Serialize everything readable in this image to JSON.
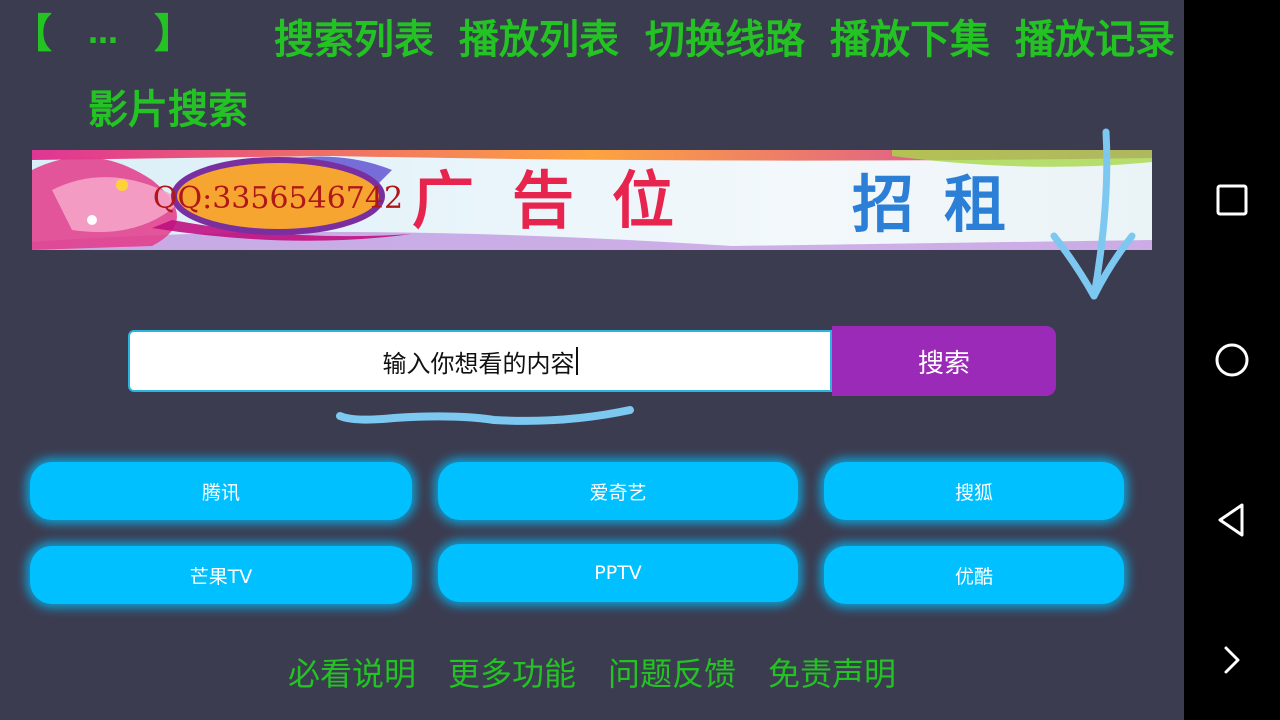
{
  "top_nav": {
    "bracket_open": "【",
    "ellipsis": "…",
    "bracket_close": "】",
    "links": [
      "搜索列表",
      "播放列表",
      "切换线路",
      "播放下集",
      "播放记录"
    ],
    "film_search": "影片搜索"
  },
  "banner": {
    "qq_text": "QQ:3356546742",
    "ad_text_red": "广告位",
    "ad_text_blue": "招租"
  },
  "search": {
    "input_value": "输入你想看的内容",
    "button_label": "搜索"
  },
  "platforms": [
    "腾讯",
    "爱奇艺",
    "搜狐",
    "芒果TV",
    "PPTV",
    "优酷"
  ],
  "footer": [
    "必看说明",
    "更多功能",
    "问题反馈",
    "免责声明"
  ],
  "colors": {
    "background": "#3c3c50",
    "accent_green": "#22c322",
    "search_button": "#9b2ab8",
    "platform_button": "#00c0ff",
    "scribble": "#7cc8f0"
  },
  "system_nav": {
    "icons": [
      "square-icon",
      "circle-icon",
      "back-triangle-icon",
      "chevron-right-icon"
    ]
  }
}
